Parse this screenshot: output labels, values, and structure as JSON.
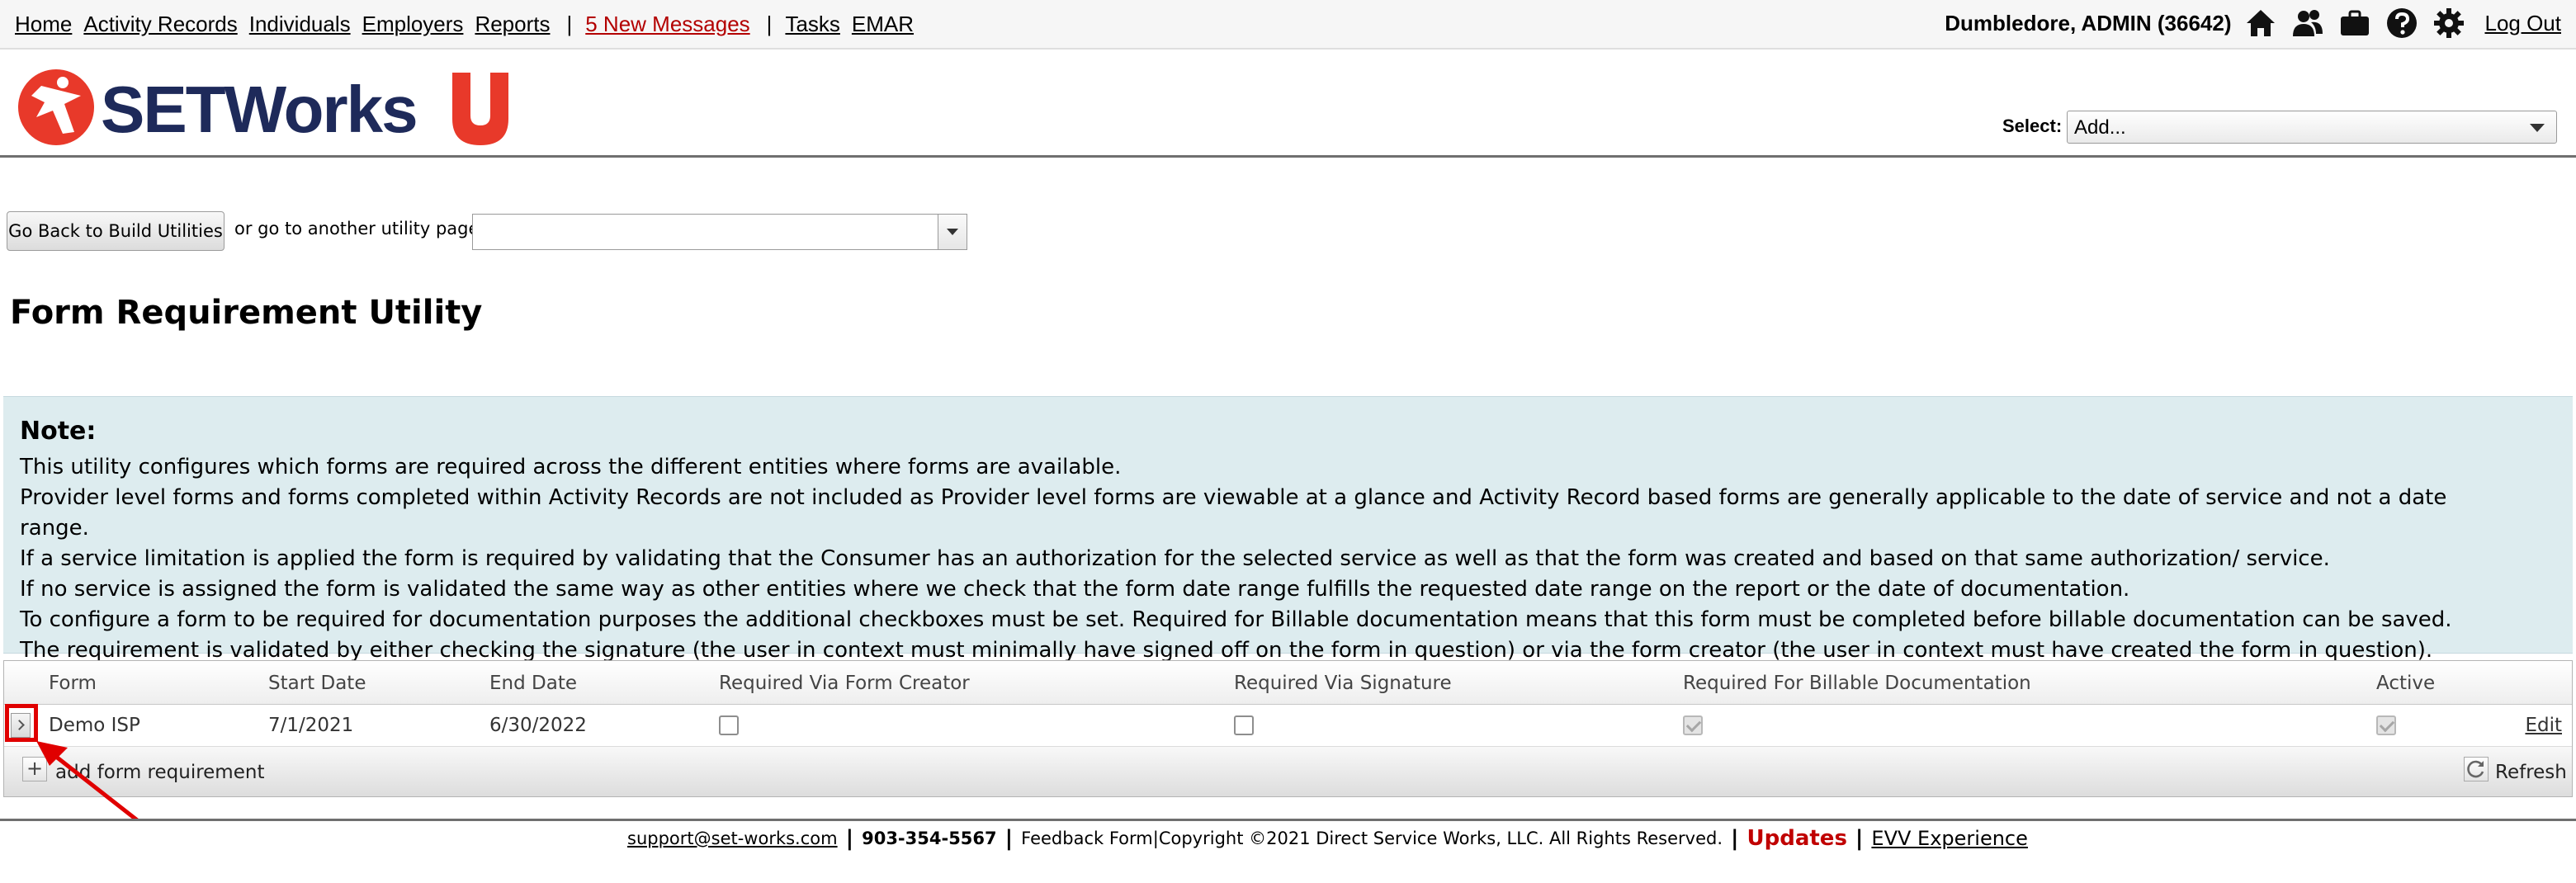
{
  "nav": {
    "links": [
      "Home",
      "Activity Records",
      "Individuals",
      "Employers",
      "Reports"
    ],
    "messages": "5 New Messages",
    "links2": [
      "Tasks",
      "EMAR"
    ],
    "separator": "|",
    "user": "Dumbledore, ADMIN  (36642)",
    "icons": [
      "home-icon",
      "people-icon",
      "briefcase-icon",
      "help-icon",
      "gear-icon"
    ],
    "logout": "Log Out"
  },
  "header": {
    "logo_text": "SETWorks",
    "logo_badge": "U",
    "select_label": "Select:",
    "select_value": "Add..."
  },
  "utility": {
    "back_button": "Go Back to Build Utilities",
    "goto_text": "or go to another utility page:",
    "goto_value": ""
  },
  "page_title": "Form Requirement Utility",
  "note": {
    "heading": "Note:",
    "lines": [
      "This utility configures which forms are required across the different entities where forms are available.",
      "Provider level forms and forms completed within Activity Records are not included as Provider level forms are viewable at a glance and Activity Record based forms are generally applicable to the date of service and not a date range.",
      "If a service limitation is applied the form is required by validating that the Consumer has an authorization for the selected service as well as that the form was created and based on that same authorization/ service.",
      "If no service is assigned the form is validated the same way as other entities where we check that the form date range fulfills the requested date range on the report or the date of documentation.",
      "To configure a form to be required for documentation purposes the additional checkboxes must be set. Required for Billable documentation means that this form must be completed before billable documentation can be saved. The requirement is validated by either checking the signature (the user in context must minimally have signed off on the form in question) or via the form creator (the user in context must have created the form in question)."
    ]
  },
  "grid": {
    "columns": [
      "Form",
      "Start Date",
      "End Date",
      "Required Via Form Creator",
      "Required Via Signature",
      "Required For Billable Documentation",
      "Active"
    ],
    "rows": [
      {
        "form": "Demo ISP",
        "start_date": "7/1/2021",
        "end_date": "6/30/2022",
        "required_via_form_creator": false,
        "required_via_signature": false,
        "required_for_billable_documentation": true,
        "active": true,
        "edit": "Edit"
      }
    ],
    "add_label": "add form requirement",
    "add_symbol": "+",
    "refresh_label": "Refresh"
  },
  "footer": {
    "email": "support@set-works.com",
    "phone": "903-354-5567",
    "feedback": "Feedback Form",
    "copyright": "Copyright ©2021 Direct Service Works, LLC. All Rights Reserved.",
    "updates": "Updates",
    "evv": "EVV Experience"
  },
  "colors": {
    "accent_red": "#b30000",
    "logo_navy": "#1e2a5a",
    "logo_red": "#e8392a",
    "note_bg": "#ddecef",
    "annotation": "#e00000"
  }
}
